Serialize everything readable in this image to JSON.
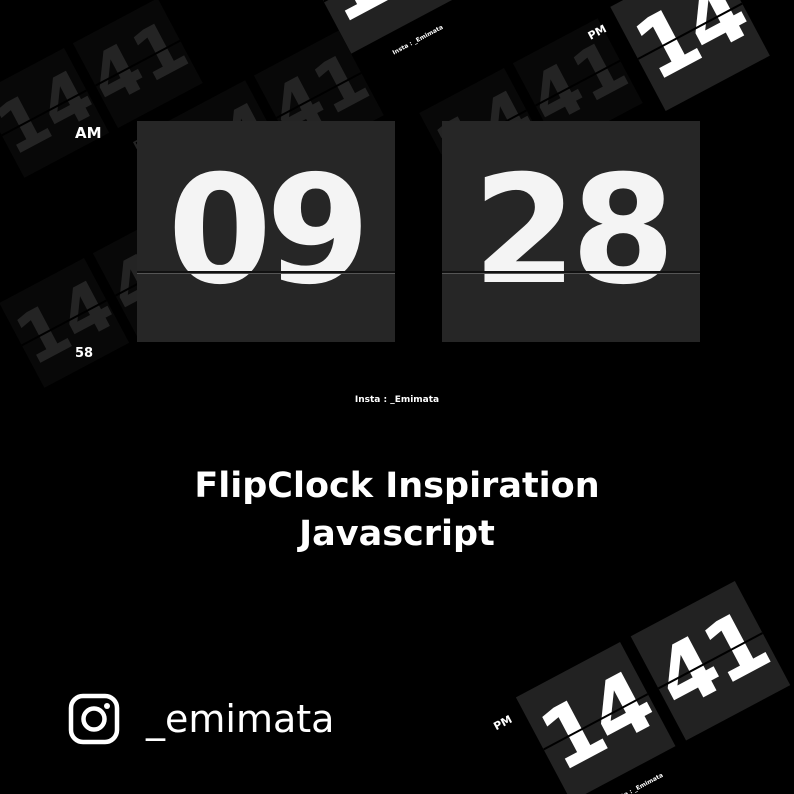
{
  "clock": {
    "hours": "09",
    "minutes": "28",
    "meridiem": "AM",
    "seconds": "58",
    "credit": "Insta : _Emimata"
  },
  "headline": {
    "line1": "FlipClock Inspiration",
    "line2": "Javascript"
  },
  "footer": {
    "icon": "instagram-icon",
    "handle": "_emimata"
  },
  "background_clocks": [
    {
      "meridiem": "PM",
      "hours": "14",
      "minutes": "41",
      "credit": "Insta : _Emimata"
    }
  ],
  "colors": {
    "background": "#000000",
    "card": "#262626",
    "digits": "#f4f4f4",
    "text": "#ffffff"
  }
}
